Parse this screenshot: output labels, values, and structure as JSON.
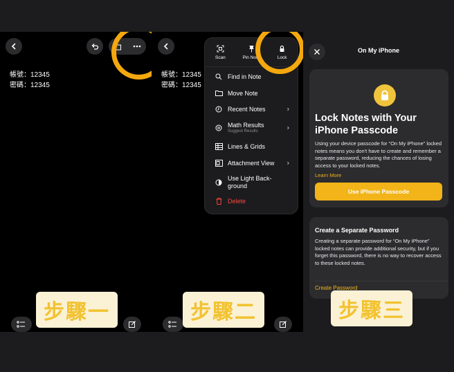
{
  "step_labels": [
    "步驟一",
    "步驟二",
    "步驟三"
  ],
  "note": {
    "account_line": "帳號：12345",
    "password_line": "密碼：12345"
  },
  "menu": {
    "top": [
      {
        "label": "Scan",
        "icon": "scan-icon"
      },
      {
        "label": "Pin Note",
        "icon": "pin-icon"
      },
      {
        "label": "Lock",
        "icon": "lock-icon"
      }
    ],
    "items": [
      {
        "label": "Find in Note",
        "icon": "search-icon"
      },
      {
        "label": "Move Note",
        "icon": "folder-icon"
      },
      {
        "label": "Recent Notes",
        "icon": "clock-icon",
        "chevron": true
      },
      {
        "label": "Math Results",
        "sub": "Suggest Results",
        "icon": "math-icon",
        "chevron": true
      },
      {
        "label": "Lines & Grids",
        "icon": "grid-icon"
      },
      {
        "label": "Attachment View",
        "icon": "attachment-icon",
        "chevron": true
      },
      {
        "label": "Use Light Back-",
        "label2": "ground",
        "icon": "contrast-icon"
      },
      {
        "label": "Delete",
        "icon": "trash-icon",
        "destructive": true
      }
    ]
  },
  "lock_screen": {
    "header_title": "On My iPhone",
    "card1": {
      "title_line1": "Lock Notes with Your",
      "title_line2": "iPhone Passcode",
      "body": "Using your device passcode for “On My iPhone” locked notes means you don't have to create and remember a separate password, reducing the chances of losing access to your locked notes.",
      "link": "Learn More",
      "button": "Use iPhone Passcode"
    },
    "card2": {
      "title": "Create a Separate Password",
      "body": "Creating a separate password for “On My iPhone” locked notes can provide additional security, but if you forget this password, there is no way to recover access to these locked notes.",
      "link": "Create Password"
    }
  },
  "colors": {
    "accent": "#f2b418",
    "ring": "#f5a80e",
    "delete": "#ff453a",
    "step_bg": "#fbf2d5",
    "step_text": "#f2c230"
  }
}
